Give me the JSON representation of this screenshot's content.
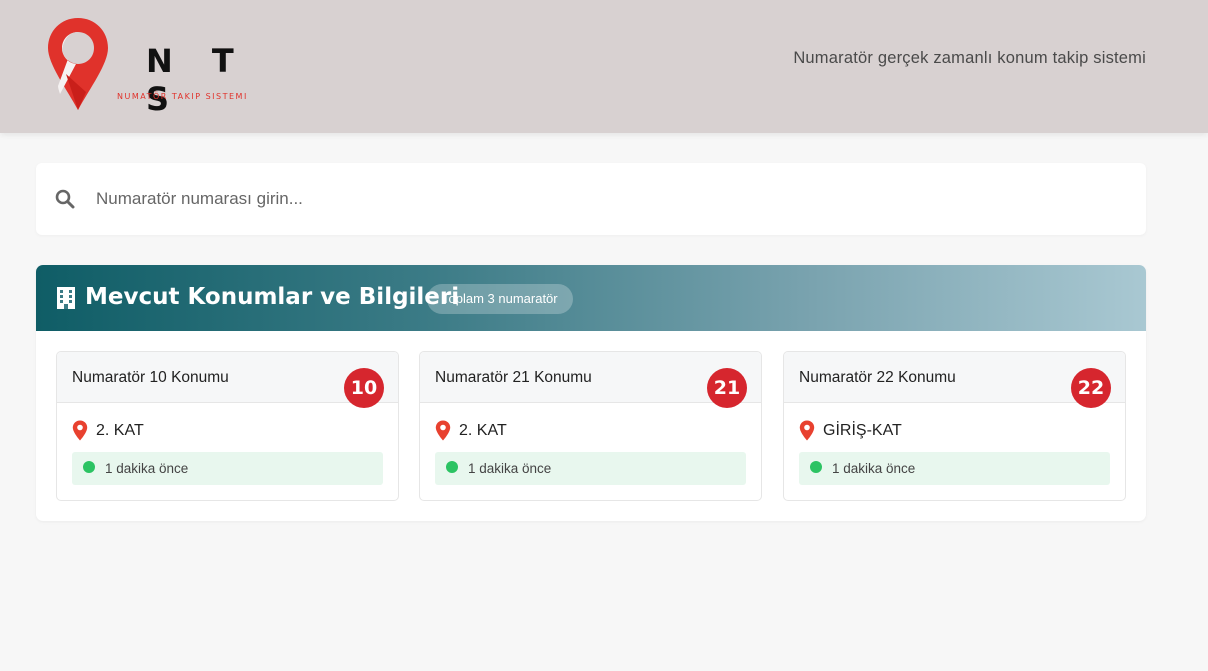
{
  "header": {
    "logo_letters": "N T S",
    "logo_subtitle": "NUMATÖR TAKIP SISTEMI",
    "tagline": "Numaratör gerçek zamanlı konum takip sistemi"
  },
  "search": {
    "placeholder": "Numaratör numarası girin...",
    "value": ""
  },
  "panel": {
    "title": "Mevcut Konumlar ve Bilgileri",
    "count_badge": "Toplam 3 numaratör"
  },
  "cards": [
    {
      "title": "Numaratör 10 Konumu",
      "number": "10",
      "location": "2. KAT",
      "status": "1 dakika önce"
    },
    {
      "title": "Numaratör 21 Konumu",
      "number": "21",
      "location": "2. KAT",
      "status": "1 dakika önce"
    },
    {
      "title": "Numaratör 22 Konumu",
      "number": "22",
      "location": "GİRİŞ-KAT",
      "status": "1 dakika önce"
    }
  ],
  "colors": {
    "brand_red": "#d6262e",
    "header_bg": "#d8d1d1",
    "panel_gradient_start": "#0f5d66",
    "panel_gradient_end": "#a9c8d2",
    "status_green": "#2cc363",
    "status_bg": "#e8f7ee"
  },
  "icons": {
    "logo": "map-pin-logo",
    "search": "search-icon",
    "panel": "building-icon",
    "location": "map-marker-icon",
    "status": "status-dot"
  }
}
